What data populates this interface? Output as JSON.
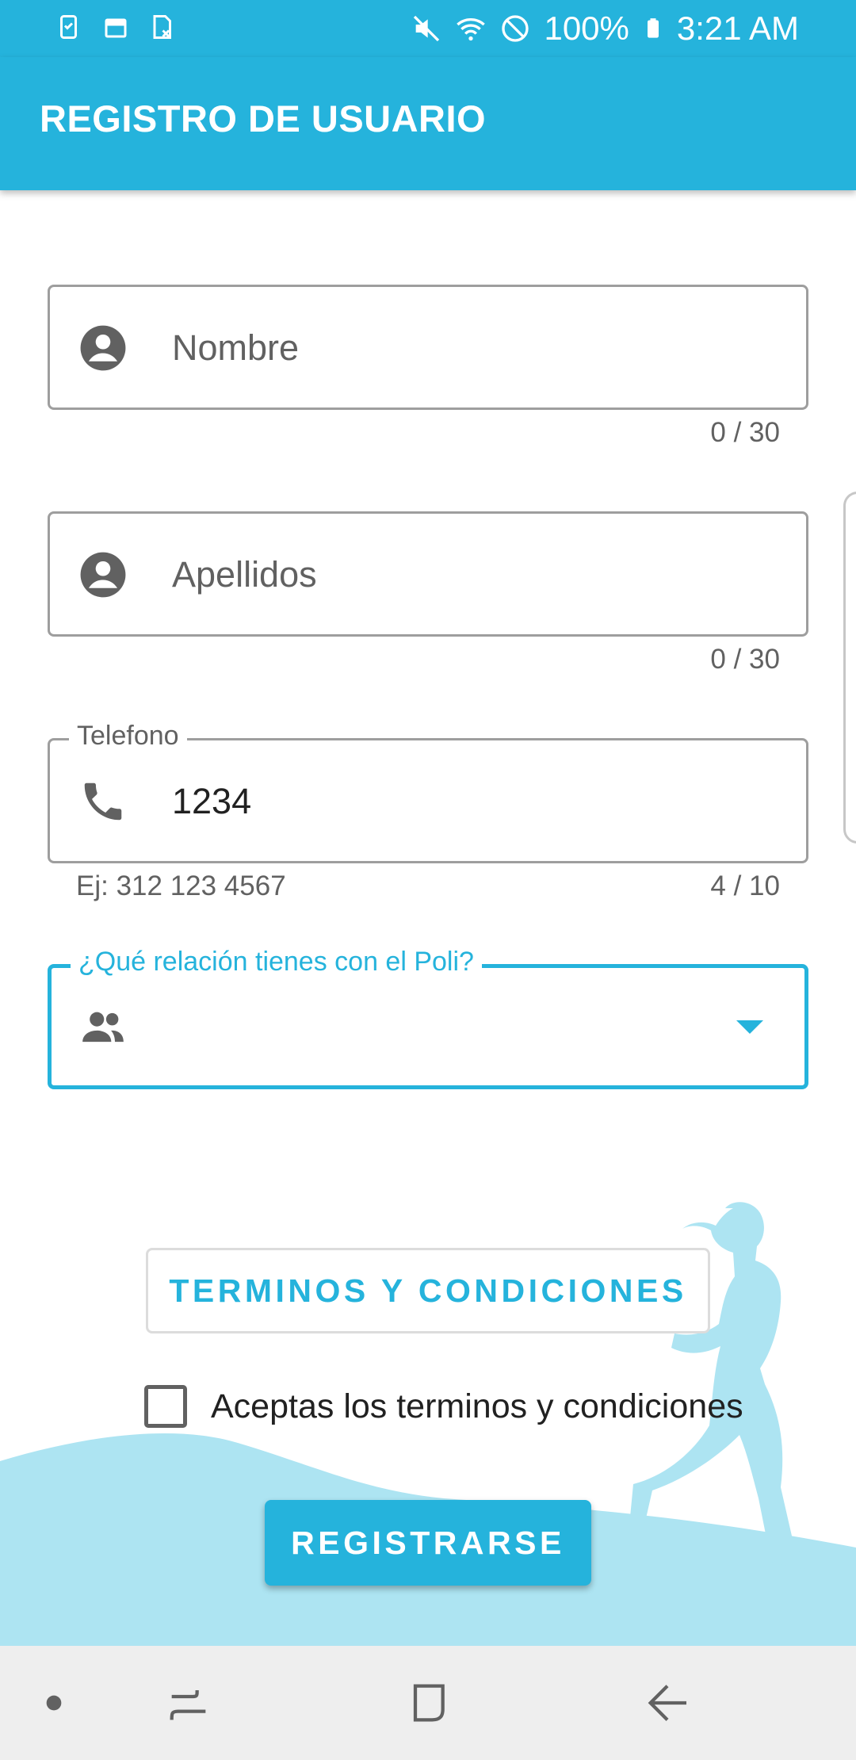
{
  "status_bar": {
    "icons_left": [
      "clipboard-check-icon",
      "calendar-icon",
      "sim-card-icon"
    ],
    "icons_right": [
      "mute-icon",
      "wifi-icon",
      "block-icon",
      "battery-icon"
    ],
    "battery": "100%",
    "time": "3:21 AM"
  },
  "app_bar": {
    "title": "REGISTRO DE USUARIO"
  },
  "form": {
    "nombre": {
      "placeholder": "Nombre",
      "value": "",
      "counter": "0 / 30",
      "icon": "account-circle-icon"
    },
    "apellidos": {
      "placeholder": "Apellidos",
      "value": "",
      "counter": "0 / 30",
      "icon": "account-circle-icon"
    },
    "telefono": {
      "label": "Telefono",
      "value": "1234",
      "helper": "Ej: 312 123 4567",
      "counter": "4 / 10",
      "icon": "phone-icon"
    },
    "relacion": {
      "label": "¿Qué relación tienes con el Poli?",
      "value": "",
      "icon": "people-icon"
    }
  },
  "terms_button": {
    "label": "TERMINOS Y CONDICIONES"
  },
  "accept": {
    "label": "Aceptas los terminos y condiciones",
    "checked": false
  },
  "register_button": {
    "label": "REGISTRARSE"
  },
  "nav_bar": {
    "items": [
      "dot-icon",
      "recents-icon",
      "home-icon",
      "back-icon"
    ]
  },
  "colors": {
    "accent": "#25b3dc",
    "decoration": "#ade4f2",
    "nav_bg": "#eeeeee"
  }
}
